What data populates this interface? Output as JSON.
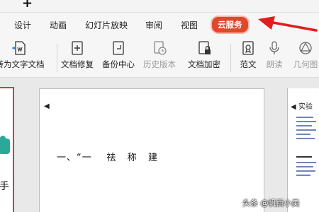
{
  "window": {
    "new_tab_glyph": "+"
  },
  "menu": {
    "items": [
      {
        "label": "设计"
      },
      {
        "label": "动画"
      },
      {
        "label": "幻灯片放映"
      },
      {
        "label": "审阅"
      },
      {
        "label": "视图"
      },
      {
        "label": "云服务",
        "active": true
      }
    ]
  },
  "annotation": {
    "arrow_color": "#e11d1d"
  },
  "toolbar": {
    "convert_label": "转为文字文档",
    "repair_label": "文档修复",
    "backup_label": "备份中心",
    "history_label": "历史版本",
    "encrypt_label": "文档加密",
    "sample_label": "范文",
    "read_label": "朗读",
    "geometry_label": "几何图"
  },
  "left_panel": {
    "partial_text": "手"
  },
  "slide": {
    "marker": "◀",
    "heading": "一、“一￼￼ ￼ ￼ ￼ 祛 ￼ ￼ 称 ￼ ￼ 建 ￼"
  },
  "preview": {
    "title": "◀ 实验"
  },
  "watermark": {
    "text": "头条 @帆西小美"
  },
  "colors": {
    "active_menu": "#e0482c",
    "accent_teal": "#2aa99b",
    "highlight_border": "#d83a3a"
  }
}
